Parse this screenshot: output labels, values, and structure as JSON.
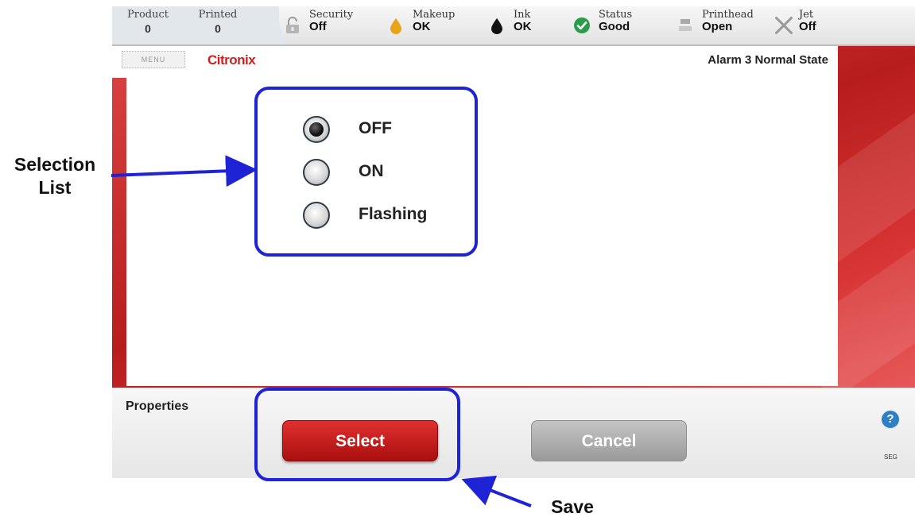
{
  "status_bar": {
    "product": {
      "label": "Product",
      "value": "0"
    },
    "printed": {
      "label": "Printed",
      "value": "0"
    },
    "items": [
      {
        "label": "Security",
        "value": "Off",
        "icon": "lock-icon"
      },
      {
        "label": "Makeup",
        "value": "OK",
        "icon": "droplet-icon",
        "color": "#e8a317"
      },
      {
        "label": "Ink",
        "value": "OK",
        "icon": "droplet-icon",
        "color": "#111111"
      },
      {
        "label": "Status",
        "value": "Good",
        "icon": "check-circle-icon",
        "color": "#2a9d4a"
      },
      {
        "label": "Printhead",
        "value": "Open",
        "icon": "printhead-icon"
      },
      {
        "label": "Jet",
        "value": "Off",
        "icon": "x-icon"
      }
    ]
  },
  "menu": {
    "label": "MENU"
  },
  "brand": {
    "logo_text": "Citronix"
  },
  "page_title": "Alarm 3 Normal State",
  "selection_list": {
    "options": [
      {
        "label": "OFF",
        "selected": true
      },
      {
        "label": "ON",
        "selected": false
      },
      {
        "label": "Flashing",
        "selected": false
      }
    ]
  },
  "bottom_bar": {
    "properties_label": "Properties",
    "select_label": "Select",
    "cancel_label": "Cancel",
    "help_symbol": "?",
    "mini_label": "SEG"
  },
  "annotations": {
    "selection_list": "Selection\nList",
    "save": "Save",
    "color": "#1f23d6"
  },
  "colors": {
    "brand_red": "#cc1f1f",
    "select_button": "#c41d1d",
    "cancel_button": "#a8a8a8"
  }
}
